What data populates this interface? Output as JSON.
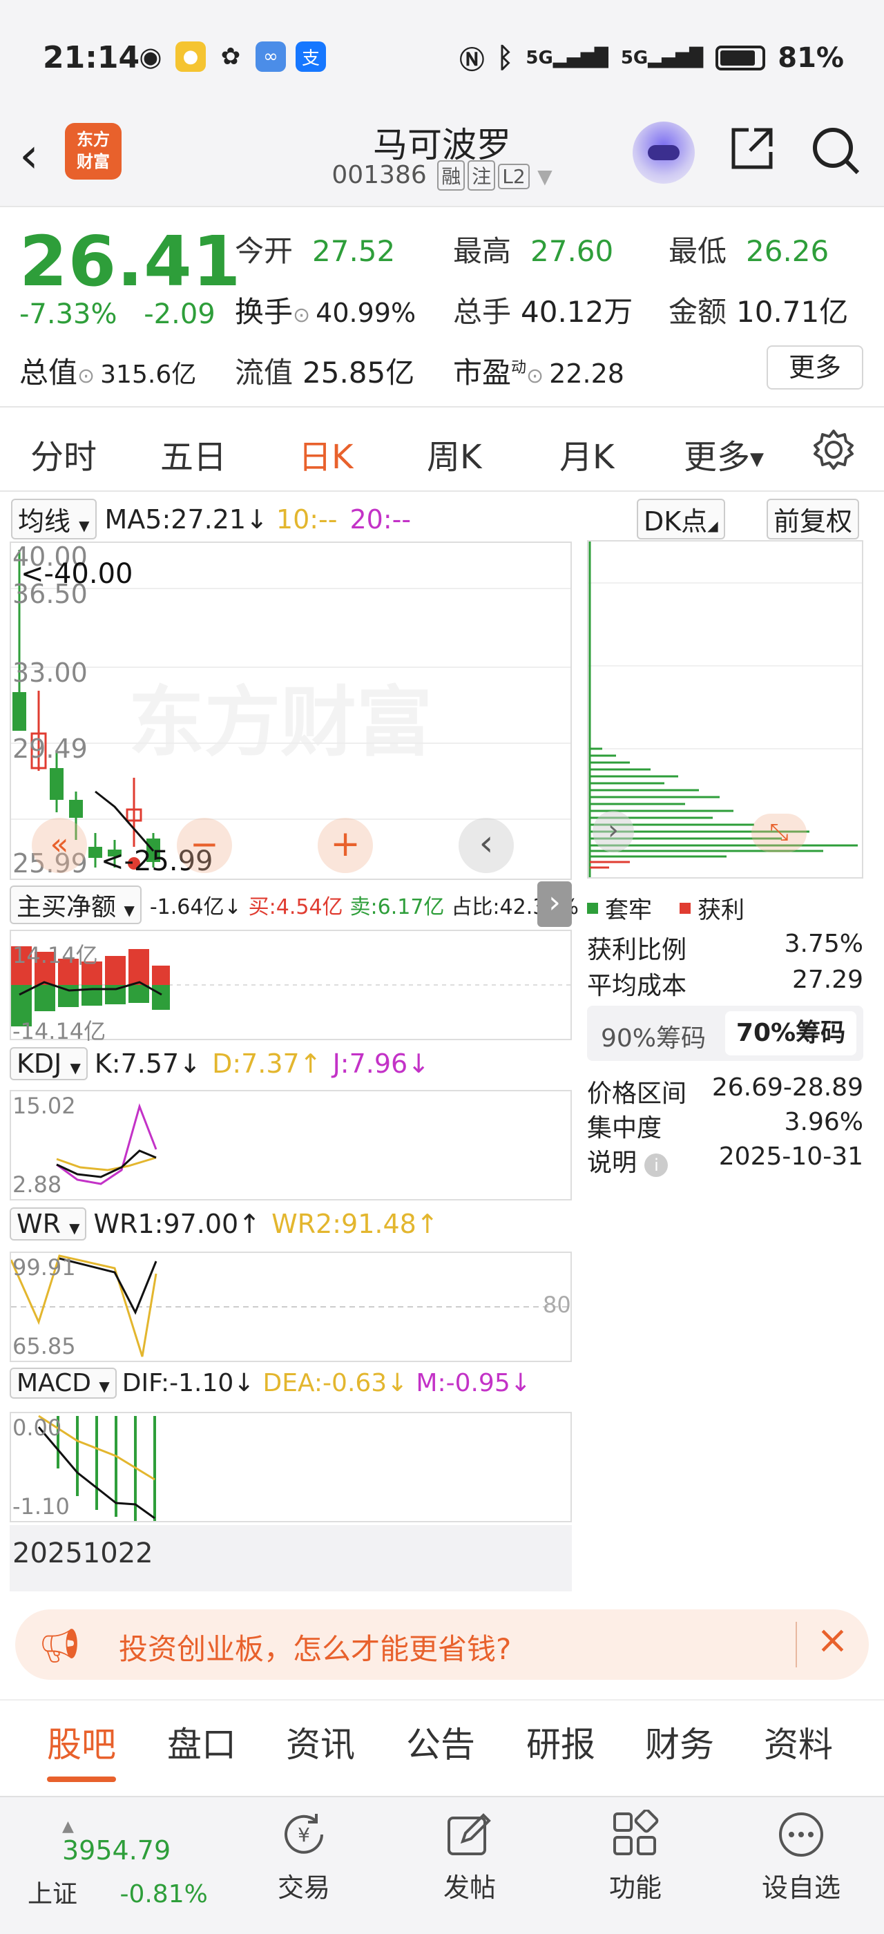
{
  "status_bar": {
    "time": "21:14",
    "network1": "5G",
    "network2": "5G",
    "battery": "81%",
    "app_icons": [
      "eye-icon",
      "weibo-icon",
      "wechat-icon",
      "app-icon",
      "alipay-icon"
    ]
  },
  "header": {
    "logo_line1": "东方",
    "logo_line2": "财富",
    "stock_name": "马可波罗",
    "stock_code": "001386",
    "tags": [
      "融",
      "注",
      "L2"
    ]
  },
  "quote": {
    "price": "26.41",
    "change_pct": "-7.33%",
    "change_amt": "-2.09",
    "open_label": "今开",
    "open": "27.52",
    "high_label": "最高",
    "high": "27.60",
    "low_label": "最低",
    "low": "26.26",
    "turnover_label": "换手",
    "turnover": "40.99%",
    "volume_label": "总手",
    "volume": "40.12万",
    "amount_label": "金额",
    "amount": "10.71亿",
    "mktcap_label": "总值",
    "mktcap": "315.6亿",
    "float_label": "流值",
    "float": "25.85亿",
    "pe_label": "市盈",
    "pe_sup": "动",
    "pe": "22.28",
    "more_label": "更多"
  },
  "period_tabs": [
    "分时",
    "五日",
    "日K",
    "周K",
    "月K",
    "更多"
  ],
  "active_tab": "日K",
  "ma_line": {
    "selector": "均线",
    "ma5": "MA5:27.21",
    "ma10": "10:--",
    "ma20": "20:--",
    "dk_label": "DK点",
    "adjust_label": "前复权"
  },
  "kline": {
    "y_ticks": [
      "40.00",
      "36.50",
      "33.00",
      "29.49",
      "25.99"
    ],
    "high_marker": "<-40.00",
    "low_marker": "<-25.99",
    "watermark": "东方财富"
  },
  "netflow": {
    "selector": "主买净额",
    "value": "-1.64亿",
    "buy": "买:4.54亿",
    "sell": "卖:6.17亿",
    "ratio": "占比:42.37%",
    "y_top": "14.14亿",
    "y_bottom": "-14.14亿"
  },
  "kdj": {
    "selector": "KDJ",
    "k": "K:7.57",
    "d": "D:7.37",
    "j": "J:7.96",
    "y_top": "15.02",
    "y_bottom": "2.88"
  },
  "wr": {
    "selector": "WR",
    "wr1": "WR1:97.00",
    "wr2": "WR2:91.48",
    "y_top": "99.91",
    "y_bottom": "65.85",
    "ref_line": "80"
  },
  "macd": {
    "selector": "MACD",
    "dif": "DIF:-1.10",
    "dea": "DEA:-0.63",
    "m": "M:-0.95",
    "y_top": "0.00",
    "y_bottom": "-1.10",
    "date": "20251022"
  },
  "chips": {
    "legend_trapped": "套牢",
    "legend_profit": "获利",
    "profit_ratio_label": "获利比例",
    "profit_ratio": "3.75%",
    "avg_cost_label": "平均成本",
    "avg_cost": "27.29",
    "tab90": "90%筹码",
    "tab70": "70%筹码",
    "range_label": "价格区间",
    "range": "26.69-28.89",
    "concentration_label": "集中度",
    "concentration": "3.96%",
    "note_label": "说明",
    "note_date": "2025-10-31"
  },
  "banner": {
    "text": "投资创业板，怎么才能更省钱?"
  },
  "bottom_tabs": [
    "股吧",
    "盘口",
    "资讯",
    "公告",
    "研报",
    "财务",
    "资料"
  ],
  "nav": {
    "index_value": "3954.79",
    "index_name": "上证",
    "index_change": "-0.81%",
    "trade": "交易",
    "post": "发帖",
    "features": "功能",
    "watchlist": "设自选"
  },
  "colors": {
    "accent": "#e8612c",
    "down": "#2e9e3a",
    "up": "#e03c31",
    "dea": "#e3b62e",
    "j_line": "#c332c7"
  }
}
